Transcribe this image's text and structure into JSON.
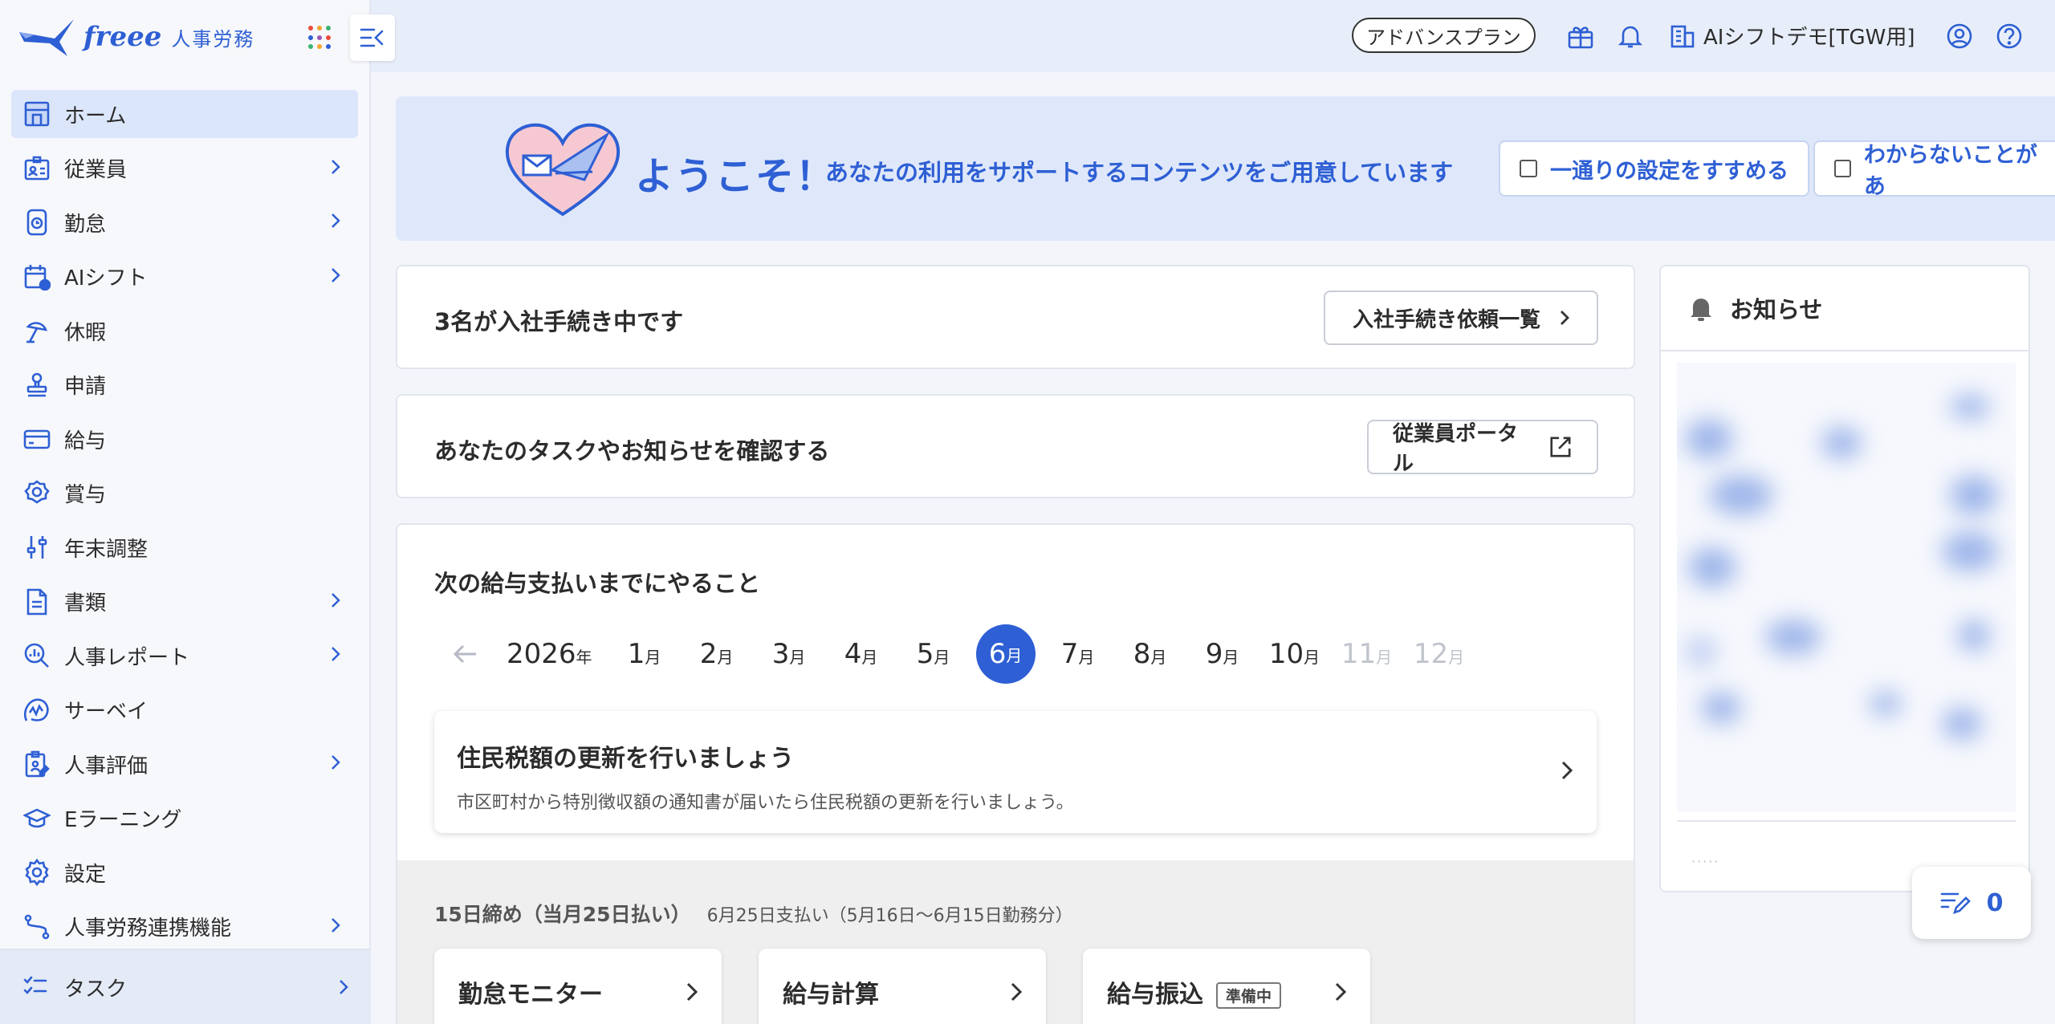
{
  "app": {
    "logo_text": "freee",
    "logo_sub": "人事労務"
  },
  "sidebar": {
    "items": [
      {
        "label": "ホーム",
        "icon": "home-icon",
        "active": true,
        "chevron": false
      },
      {
        "label": "従業員",
        "icon": "employee-card-icon",
        "chevron": true
      },
      {
        "label": "勤怠",
        "icon": "clock-watch-icon",
        "chevron": true
      },
      {
        "label": "AIシフト",
        "icon": "calendar-clock-icon",
        "chevron": true
      },
      {
        "label": "休暇",
        "icon": "umbrella-icon",
        "chevron": false
      },
      {
        "label": "申請",
        "icon": "stamp-icon",
        "chevron": false
      },
      {
        "label": "給与",
        "icon": "wallet-card-icon",
        "chevron": false
      },
      {
        "label": "賞与",
        "icon": "medal-icon",
        "chevron": false
      },
      {
        "label": "年末調整",
        "icon": "sliders-icon",
        "chevron": false
      },
      {
        "label": "書類",
        "icon": "document-icon",
        "chevron": true
      },
      {
        "label": "人事レポート",
        "icon": "report-search-icon",
        "chevron": true
      },
      {
        "label": "サーベイ",
        "icon": "survey-pulse-icon",
        "chevron": false
      },
      {
        "label": "人事評価",
        "icon": "evaluation-clipboard-icon",
        "chevron": true
      },
      {
        "label": "Eラーニング",
        "icon": "graduation-cap-icon",
        "chevron": false
      },
      {
        "label": "設定",
        "icon": "gear-icon",
        "chevron": false
      },
      {
        "label": "人事労務連携機能",
        "icon": "integration-route-icon",
        "chevron": true
      }
    ],
    "task_label": "タスク"
  },
  "header": {
    "plan": "アドバンスプラン",
    "company": "AIシフトデモ[TGW用]"
  },
  "welcome": {
    "title": "ようこそ！",
    "subtitle": "あなたの利用をサポートするコンテンツをご用意しています",
    "buttons": [
      "一通りの設定をすすめる",
      "わからないことがあ"
    ]
  },
  "onboarding_card": {
    "title": "3名が入社手続き中です",
    "button": "入社手続き依頼一覧"
  },
  "portal_card": {
    "title": "あなたのタスクやお知らせを確認する",
    "button": "従業員ポータル"
  },
  "payroll": {
    "title": "次の給与支払いまでにやること",
    "year": "2026",
    "year_suffix": "年",
    "month_suffix": "月",
    "months": [
      "1",
      "2",
      "3",
      "4",
      "5",
      "6",
      "7",
      "8",
      "9",
      "10",
      "11",
      "12"
    ],
    "selected_month": "6",
    "disabled_months": [
      "11",
      "12"
    ],
    "task": {
      "title": "住民税額の更新を行いましょう",
      "description": "市区町村から特別徴収額の通知書が届いたら住民税額の更新を行いましょう。"
    },
    "cycle_title": "15日締め（当月25日払い）",
    "cycle_detail": "6月25日支払い（5月16日〜6月15日勤務分）",
    "steps": [
      {
        "label": "勤怠モニター"
      },
      {
        "label": "給与計算"
      },
      {
        "label": "給与振込",
        "badge": "準備中"
      }
    ]
  },
  "notice": {
    "title": "お知らせ",
    "footer": "·····"
  },
  "fab": {
    "count": "0"
  },
  "colors": {
    "brand": "#2e5fd4",
    "active_bg": "#dce6fb",
    "banner_bg": "#dfe8fa"
  }
}
